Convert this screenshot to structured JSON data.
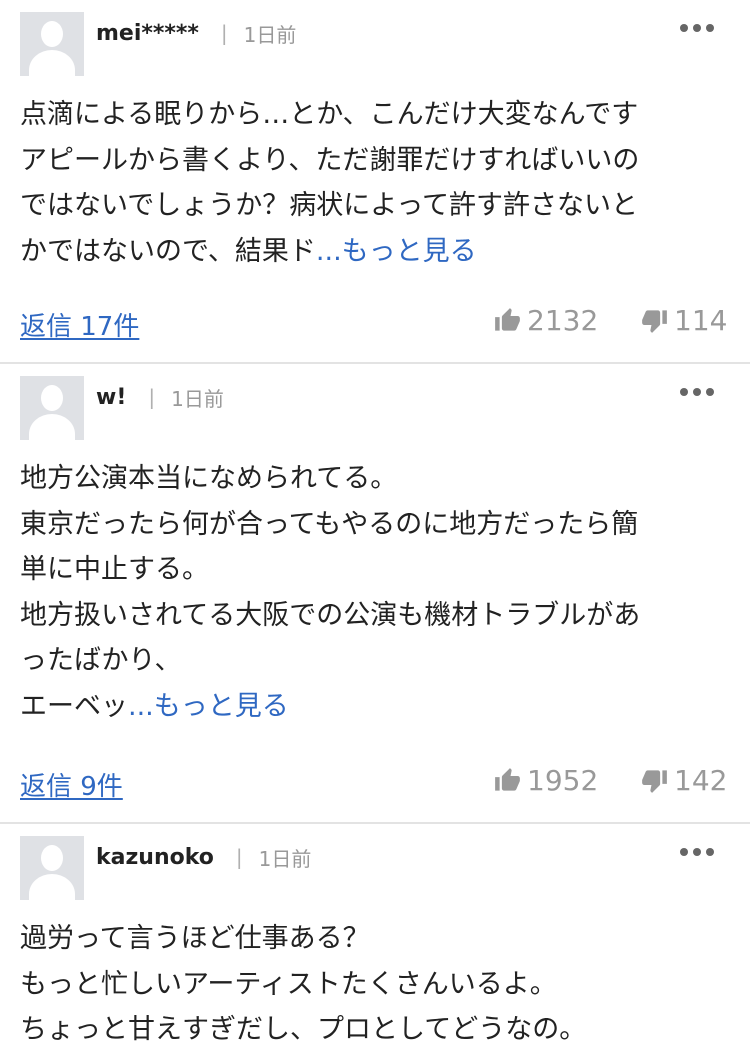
{
  "comments": [
    {
      "user": "mei*****",
      "separator": "|",
      "time": "1日前",
      "lines": [
        "点滴による眠りから…とか、こんだけ大変なんです",
        "アピールから書くより、ただ謝罪だけすればいいの",
        "ではないでしょうか？病状によって許す許さないと",
        "かではないので、結果ド"
      ],
      "more_label": "...もっと見る",
      "replies_label": "返信 17件",
      "likes": "2132",
      "dislikes": "114"
    },
    {
      "user": "w!",
      "separator": "|",
      "time": "1日前",
      "lines": [
        "地方公演本当になめられてる。",
        "東京だったら何が合ってもやるのに地方だったら簡",
        "単に中止する。",
        "地方扱いされてる大阪での公演も機材トラブルがあ",
        "ったばかり、",
        "エーベッ"
      ],
      "more_label": "...もっと見る",
      "replies_label": "返信 9件",
      "likes": "1952",
      "dislikes": "142"
    },
    {
      "user": "kazunoko",
      "separator": "|",
      "time": "1日前",
      "lines": [
        "過労って言うほど仕事ある？",
        "もっと忙しいアーティストたくさんいるよ。",
        "ちょっと甘えすぎだし、プロとしてどうなの。"
      ]
    }
  ],
  "icons": {
    "avatar": "default-user-avatar",
    "more": "more-options-icon",
    "like": "thumbs-up-icon",
    "dislike": "thumbs-down-icon"
  },
  "colors": {
    "link": "#2f68c2",
    "muted": "#999999",
    "divider": "#e3e3e3",
    "avatar_bg": "#dfe1e5"
  }
}
